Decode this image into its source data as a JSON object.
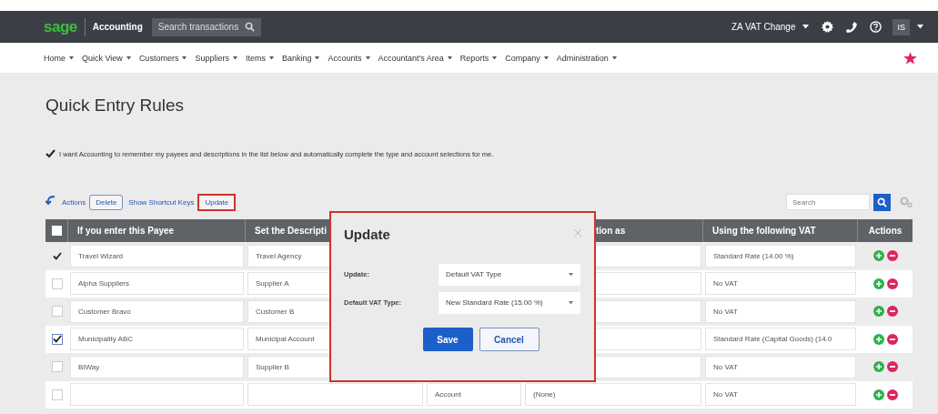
{
  "topbar": {
    "logo": "sage",
    "product": "Accounting",
    "search": {
      "placeholder": "Search transactions"
    },
    "company": "ZA VAT Change",
    "user_initials": "IS"
  },
  "nav": [
    {
      "label": "Home"
    },
    {
      "label": "Quick View"
    },
    {
      "label": "Customers"
    },
    {
      "label": "Suppliers"
    },
    {
      "label": "Items"
    },
    {
      "label": "Banking"
    },
    {
      "label": "Accounts"
    },
    {
      "label": "Accountant's Area"
    },
    {
      "label": "Reports"
    },
    {
      "label": "Company"
    },
    {
      "label": "Administration"
    }
  ],
  "page": {
    "title": "Quick Entry Rules",
    "remember": {
      "checked": true,
      "label": "I want Accounting to remember my payees and descriptions in the list below and automatically complete the type and account selections for me."
    }
  },
  "toolbar": {
    "actions": "Actions",
    "buttons": [
      {
        "label": "Delete",
        "kind": "button",
        "highlighted": false
      },
      {
        "label": "Show Shortcut Keys",
        "kind": "link",
        "highlighted": false
      },
      {
        "label": "Update",
        "kind": "button",
        "highlighted": true
      }
    ],
    "search": {
      "placeholder": "Search"
    }
  },
  "table": {
    "select_all": {
      "checked": false
    },
    "columns": [
      {
        "label": "If you enter this Payee"
      },
      {
        "label": "Set the Descripti"
      },
      {},
      {
        "label": "tion as"
      },
      {
        "label": "Using the following VAT"
      },
      {
        "label": "Actions"
      }
    ],
    "rows": [
      {
        "selected": true,
        "payee": "Travel Wizard",
        "description": "Travel Agency",
        "vat": "Standard Rate (14.00 %)"
      },
      {
        "selected": false,
        "payee": "Alpha Suppliers",
        "description": "Supplier A",
        "vat": "No VAT"
      },
      {
        "selected": false,
        "payee": "Customer Bravo",
        "description": "Customer B",
        "vat": "No VAT"
      },
      {
        "selected": true,
        "payee": "Municipality ABC",
        "description": "Municipal Account",
        "vat": "Standard Rate (Capital Goods) (14.0"
      },
      {
        "selected": false,
        "payee": "BIWay",
        "description": "Supplier B",
        "vat": "No VAT"
      },
      {
        "selected": false,
        "type": "Account",
        "account": "(None)",
        "vat": "No VAT"
      }
    ]
  },
  "dialog": {
    "title": "Update",
    "fields": [
      {
        "label": "Update:",
        "value": "Default VAT Type"
      },
      {
        "label": "Default VAT Type:",
        "value": "New Standard Rate (15.00 %)"
      }
    ],
    "buttons": [
      {
        "label": "Save",
        "kind": "primary"
      },
      {
        "label": "Cancel",
        "kind": "secondary"
      }
    ]
  }
}
